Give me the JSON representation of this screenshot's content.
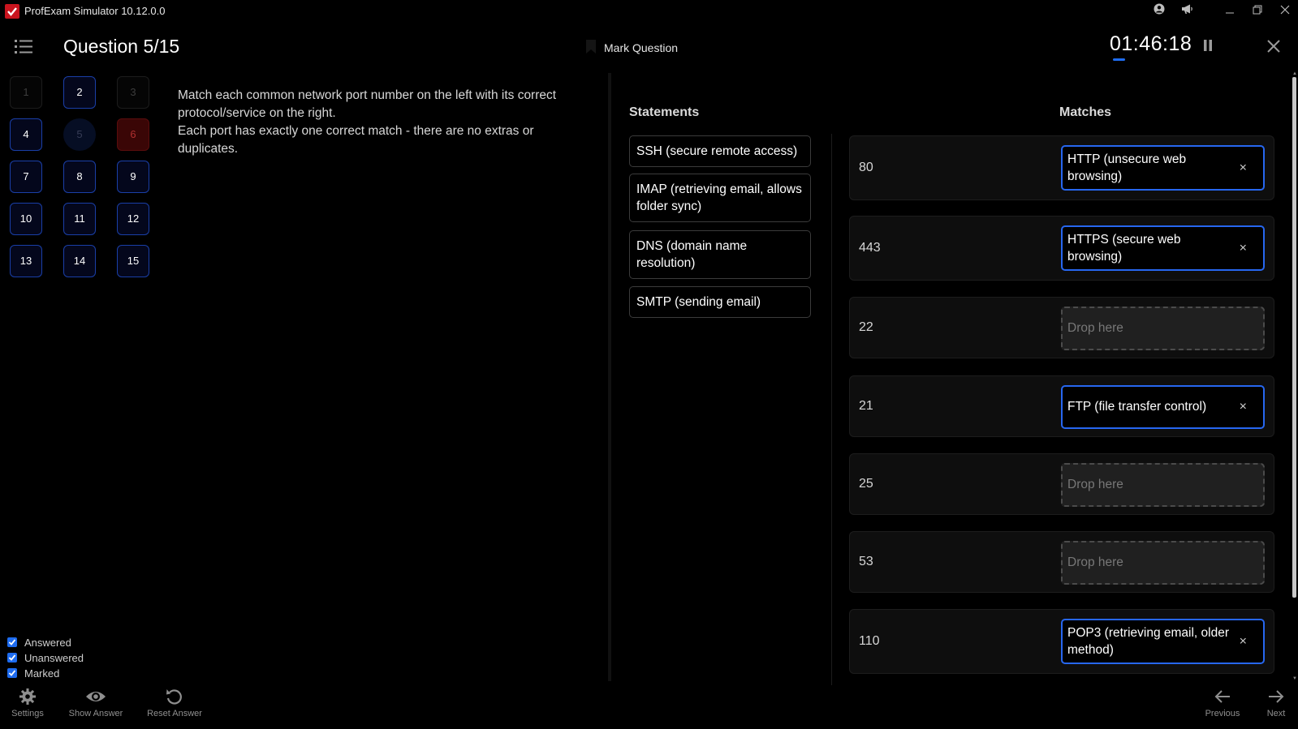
{
  "app": {
    "title": "ProfExam Simulator 10.12.0.0",
    "accent_color": "#1e6cf0",
    "brand_color": "#c8141e",
    "window_icons": [
      "user-icon",
      "megaphone-icon",
      "minimize-icon",
      "restore-icon",
      "close-icon"
    ]
  },
  "header": {
    "question_title": "Question 5/15",
    "mark_label": "Mark Question",
    "timer": "01:46:18"
  },
  "question_grid": [
    {
      "label": "1",
      "state": "unanswered"
    },
    {
      "label": "2",
      "state": "answered"
    },
    {
      "label": "3",
      "state": "unanswered"
    },
    {
      "label": "4",
      "state": "answered"
    },
    {
      "label": "5",
      "state": "current"
    },
    {
      "label": "6",
      "state": "marked"
    },
    {
      "label": "7",
      "state": "answered"
    },
    {
      "label": "8",
      "state": "answered"
    },
    {
      "label": "9",
      "state": "answered"
    },
    {
      "label": "10",
      "state": "answered"
    },
    {
      "label": "11",
      "state": "answered"
    },
    {
      "label": "12",
      "state": "answered"
    },
    {
      "label": "13",
      "state": "answered"
    },
    {
      "label": "14",
      "state": "answered"
    },
    {
      "label": "15",
      "state": "answered"
    }
  ],
  "question": {
    "line1": "Match each common network port number on the left with its correct protocol/service on the right.",
    "line2": "Each port has exactly one correct match - there are no extras or duplicates."
  },
  "statements_heading": "Statements",
  "matches_heading": "Matches",
  "statements": [
    "SSH (secure remote access)",
    "IMAP (retrieving email, allows folder sync)",
    "DNS (domain name resolution)",
    "SMTP (sending email)"
  ],
  "matches": [
    {
      "port": "80",
      "answer": "HTTP (unsecure web browsing)",
      "placeholder": ""
    },
    {
      "port": "443",
      "answer": "HTTPS (secure web browsing)",
      "placeholder": ""
    },
    {
      "port": "22",
      "answer": "",
      "placeholder": "Drop here"
    },
    {
      "port": "21",
      "answer": "FTP (file transfer control)",
      "placeholder": ""
    },
    {
      "port": "25",
      "answer": "",
      "placeholder": "Drop here"
    },
    {
      "port": "53",
      "answer": "",
      "placeholder": "Drop here"
    },
    {
      "port": "110",
      "answer": "POP3 (retrieving email, older method)",
      "placeholder": ""
    }
  ],
  "remove_glyph": "×",
  "filters": {
    "answered": "Answered",
    "unanswered": "Unanswered",
    "marked": "Marked"
  },
  "toolbar": {
    "settings": "Settings",
    "show_answer": "Show Answer",
    "reset_answer": "Reset Answer",
    "previous": "Previous",
    "next": "Next"
  }
}
